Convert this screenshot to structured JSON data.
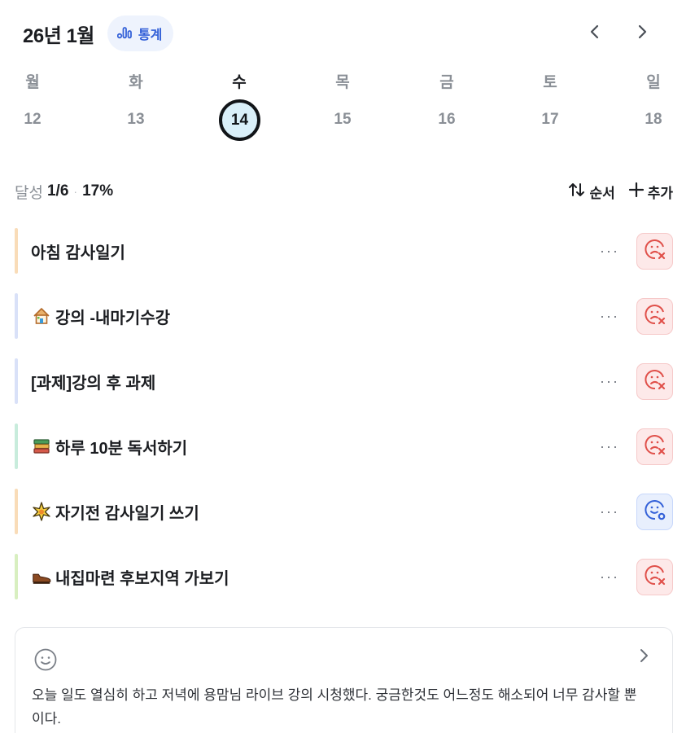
{
  "header": {
    "month_title": "26년 1월",
    "stats_label": "통계",
    "prev_icon": "chevron-left-icon",
    "next_icon": "chevron-right-icon"
  },
  "week": {
    "days": [
      {
        "label": "월",
        "num": "12",
        "active": false
      },
      {
        "label": "화",
        "num": "13",
        "active": false
      },
      {
        "label": "수",
        "num": "14",
        "active": true
      },
      {
        "label": "목",
        "num": "15",
        "active": false
      },
      {
        "label": "금",
        "num": "16",
        "active": false
      },
      {
        "label": "토",
        "num": "17",
        "active": false
      },
      {
        "label": "일",
        "num": "18",
        "active": false
      }
    ]
  },
  "summary": {
    "label": "달성",
    "count": "1/6",
    "percent": "17%",
    "sort_label": "순서",
    "add_label": "추가"
  },
  "tasks": [
    {
      "title": "아침 감사일기",
      "emoji": "",
      "bar_color": "#f9dcb8",
      "status": "fail"
    },
    {
      "title": "강의 -내마기수강",
      "emoji": "house-icon",
      "bar_color": "#d9e1f8",
      "status": "fail"
    },
    {
      "title": "[과제]강의 후 과제",
      "emoji": "",
      "bar_color": "#d9e1f8",
      "status": "fail"
    },
    {
      "title": "하루 10분 독서하기",
      "emoji": "books-icon",
      "bar_color": "#c8ecdc",
      "status": "fail"
    },
    {
      "title": "자기전 감사일기 쓰기",
      "emoji": "sparkle-icon",
      "bar_color": "#f9dcb8",
      "status": "ok"
    },
    {
      "title": "내집마련 후보지역 가보기",
      "emoji": "shoe-icon",
      "bar_color": "#d8efc0",
      "status": "fail"
    }
  ],
  "memo": {
    "text": "오늘 일도 열심히 하고 저녁에 용맘님 라이브 강의 시청했다. 궁금한것도 어느정도 해소되어 너무 감사할 뿐이다."
  },
  "colors": {
    "accent": "#3461d8",
    "fail": "#e0504a",
    "today_fill": "#d9eff9"
  }
}
